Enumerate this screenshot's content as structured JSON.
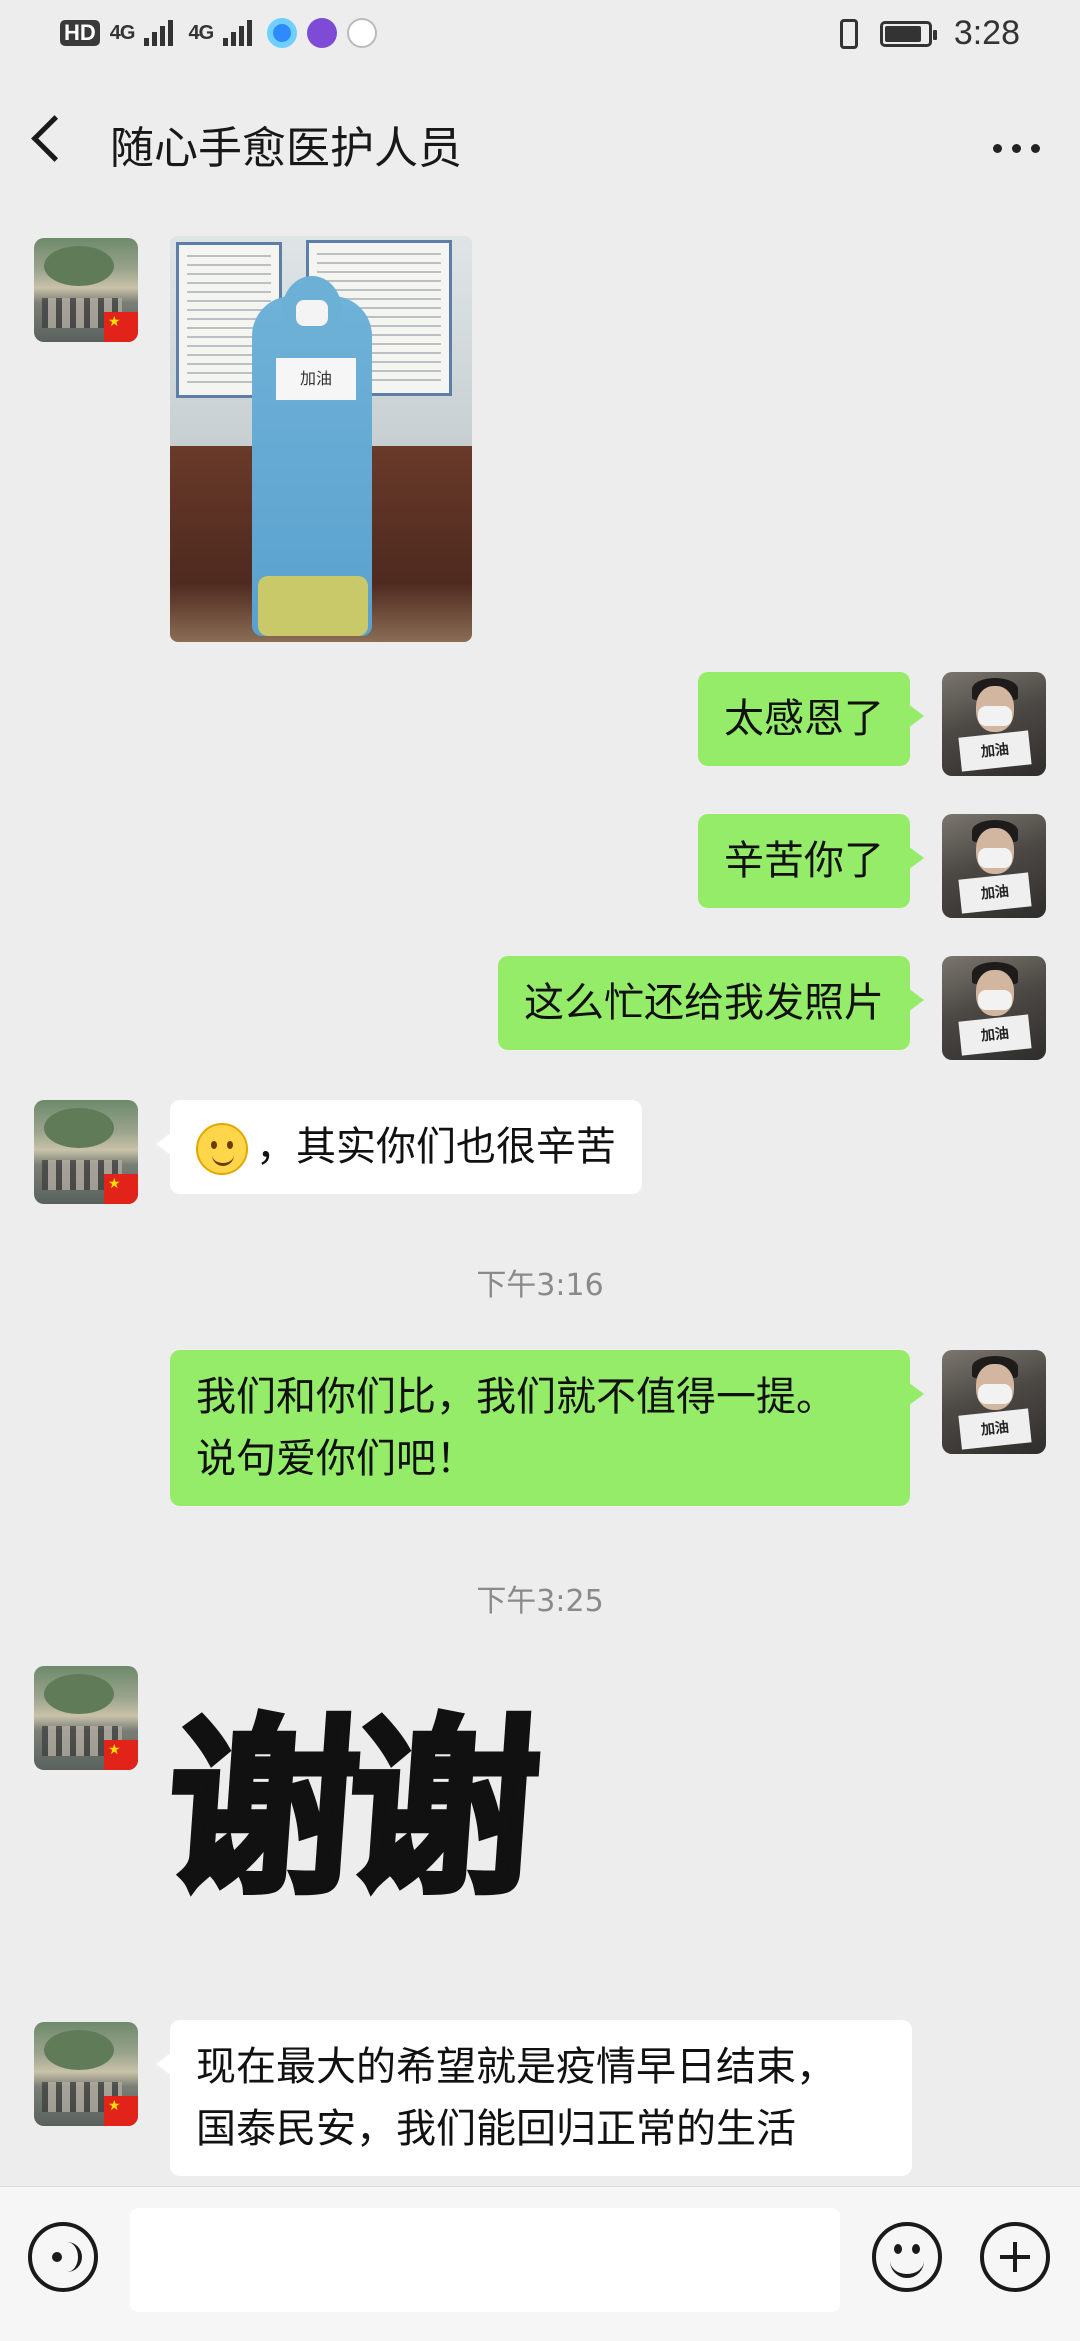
{
  "status_bar": {
    "hd": "HD",
    "sim1": "4G",
    "sim2": "4G",
    "time": "3:28",
    "battery_level": 0.85
  },
  "header": {
    "title": "随心手愈医护人员"
  },
  "messages": [
    {
      "side": "left",
      "type": "image",
      "text": "加油"
    },
    {
      "side": "right",
      "type": "text",
      "text": "太感恩了"
    },
    {
      "side": "right",
      "type": "text",
      "text": "辛苦你了"
    },
    {
      "side": "right",
      "type": "text",
      "text": "这么忙还给我发照片"
    },
    {
      "side": "left",
      "type": "text",
      "emoji": "smile-emoji",
      "text": "，其实你们也很辛苦"
    },
    {
      "type": "timestamp",
      "text": "下午3:16"
    },
    {
      "side": "right",
      "type": "text",
      "line1": "我们和你们比，我们就不值得一提。",
      "line2": "说句爱你们吧！"
    },
    {
      "type": "timestamp",
      "text": "下午3:25"
    },
    {
      "side": "left",
      "type": "sticker",
      "text": "谢谢"
    },
    {
      "side": "left",
      "type": "text",
      "line1": "现在最大的希望就是疫情早日结束，",
      "line2": "国泰民安，我们能回归正常的生活"
    }
  ],
  "avatar_right_sign": "加油",
  "input_bar": {
    "value": "",
    "placeholder": ""
  },
  "colors": {
    "background": "#ededed",
    "bubble_self": "#95ec69",
    "bubble_other": "#ffffff"
  }
}
